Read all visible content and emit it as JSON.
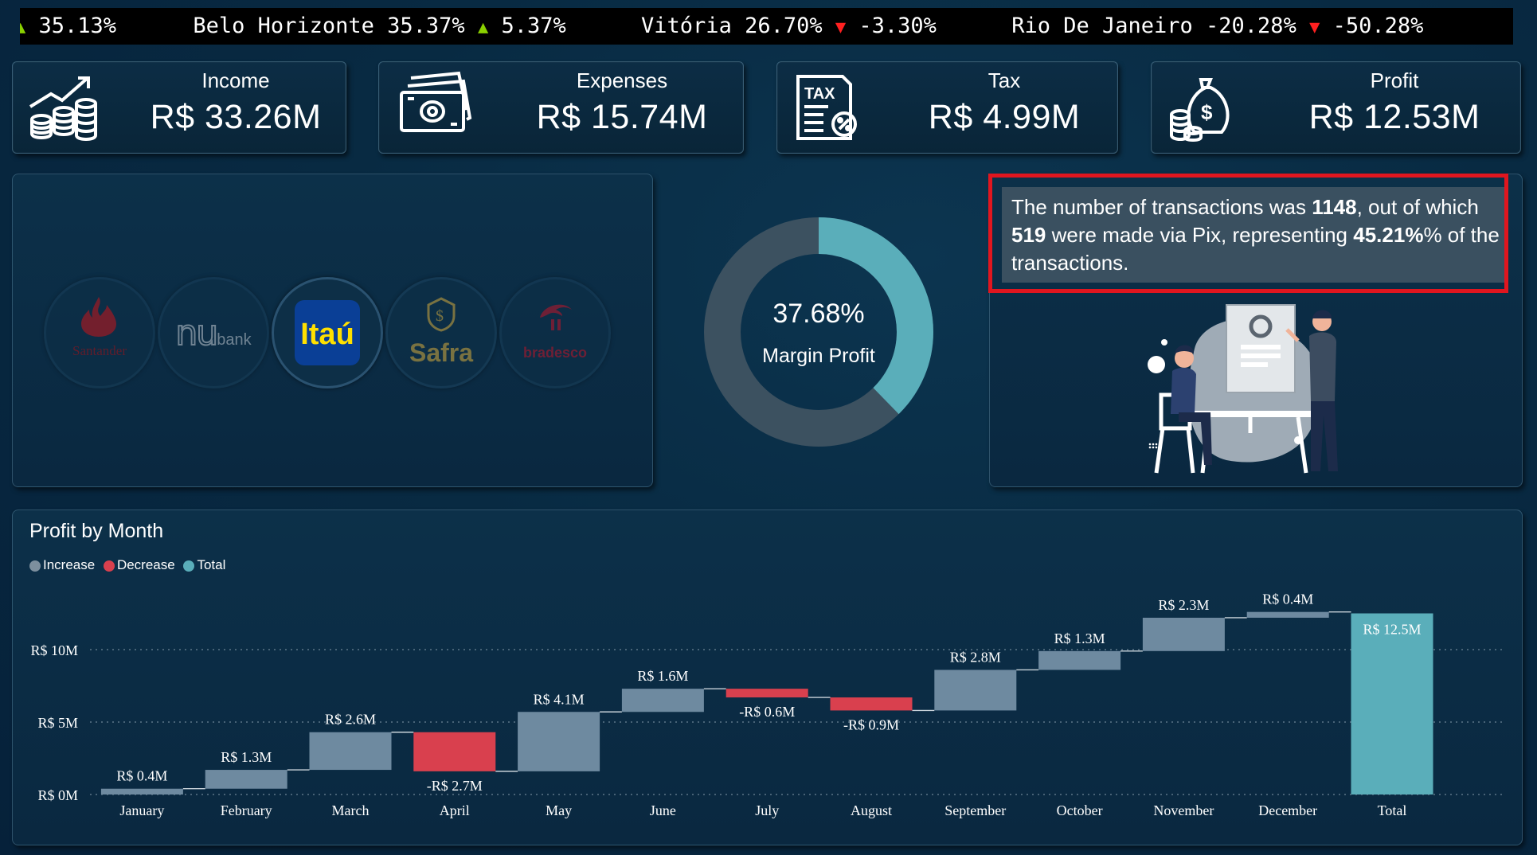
{
  "ticker": [
    {
      "text": "35.13%",
      "arrow": "up"
    },
    {
      "text": "Belo Horizonte 35.37%",
      "arrow": "up",
      "change": "5.37%"
    },
    {
      "text": "Vitória 26.70%",
      "arrow": "down",
      "change": "-3.30%"
    },
    {
      "text": "Rio De Janeiro -20.28%",
      "arrow": "down",
      "change": "-50.28%"
    }
  ],
  "kpis": {
    "income": {
      "label": "Income",
      "value": "R$ 33.26M",
      "icon": "income-growth-coins-icon"
    },
    "expenses": {
      "label": "Expenses",
      "value": "R$ 15.74M",
      "icon": "banknote-stack-icon"
    },
    "tax": {
      "label": "Tax",
      "value": "R$ 4.99M",
      "icon": "tax-document-icon"
    },
    "profit": {
      "label": "Profit",
      "value": "R$ 12.53M",
      "icon": "money-bag-coins-icon"
    }
  },
  "banks": [
    {
      "name": "Santander",
      "color": "#c8151b"
    },
    {
      "name": "nu",
      "suffix": "bank",
      "color": "#9aa3ad"
    },
    {
      "name": "Itaú",
      "color": "#ffe000",
      "bg": "#0a3f96",
      "selected": true
    },
    {
      "name": "Safra",
      "color": "#b09a3e"
    },
    {
      "name": "bradesco",
      "color": "#c0162a"
    }
  ],
  "margin": {
    "value": "37.68%",
    "label": "Margin Profit",
    "fraction": 0.3768
  },
  "transactions": {
    "p1": "The number of transactions was ",
    "total": "1148",
    "p2": ", out of which ",
    "pix": "519",
    "p3": " were made via Pix, representing ",
    "pct": "45.21%",
    "p4": "% of the transactions."
  },
  "colors": {
    "increase": "#6e8aa0",
    "decrease": "#d9404e",
    "total": "#5aaeba",
    "donut_fill": "#5aaeba",
    "donut_rest": "#3c5160"
  },
  "chart_data": {
    "type": "waterfall",
    "title": "Profit by Month",
    "legend": [
      {
        "name": "Increase",
        "color": "#7d8f9e"
      },
      {
        "name": "Decrease",
        "color": "#d9404e"
      },
      {
        "name": "Total",
        "color": "#5aaeba"
      }
    ],
    "legend_position": "top-left",
    "categories": [
      "January",
      "February",
      "March",
      "April",
      "May",
      "June",
      "July",
      "August",
      "September",
      "October",
      "November",
      "December",
      "Total"
    ],
    "values": [
      0.4,
      1.3,
      2.6,
      -2.7,
      4.1,
      1.6,
      -0.6,
      -0.9,
      2.8,
      1.3,
      2.3,
      0.4,
      12.5
    ],
    "kinds": [
      "increase",
      "increase",
      "increase",
      "decrease",
      "increase",
      "increase",
      "decrease",
      "decrease",
      "increase",
      "increase",
      "increase",
      "increase",
      "total"
    ],
    "labels": [
      "R$ 0.4M",
      "R$ 1.3M",
      "R$ 2.6M",
      "-R$ 2.7M",
      "R$ 4.1M",
      "R$ 1.6M",
      "-R$ 0.6M",
      "-R$ 0.9M",
      "R$ 2.8M",
      "R$ 1.3M",
      "R$ 2.3M",
      "R$ 0.4M",
      "R$ 12.5M"
    ],
    "y_ticks": [
      {
        "value": 0,
        "label": "R$ 0M"
      },
      {
        "value": 5,
        "label": "R$ 5M"
      },
      {
        "value": 10,
        "label": "R$ 10M"
      }
    ],
    "grid": true
  }
}
